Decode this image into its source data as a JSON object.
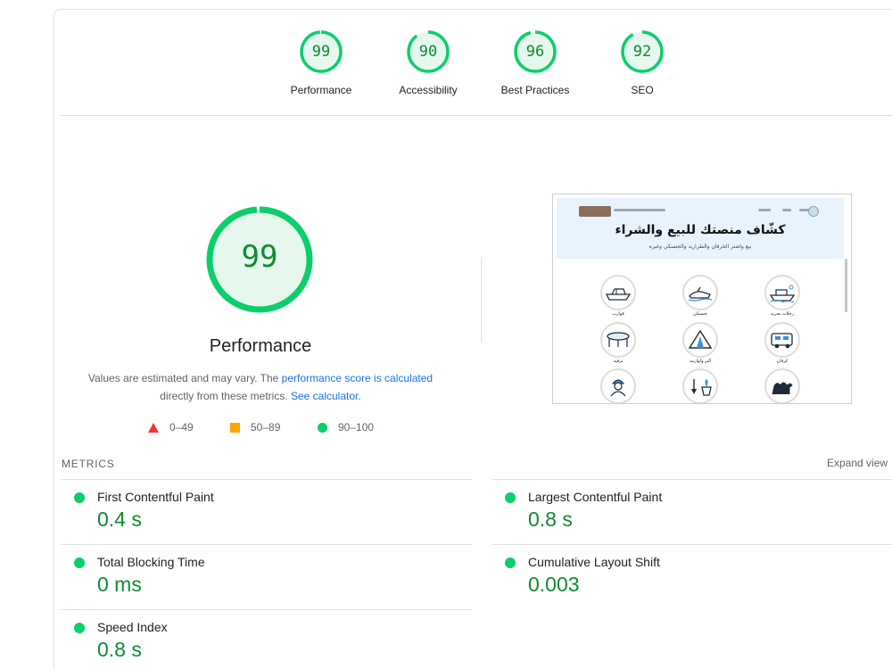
{
  "categories": [
    {
      "label": "Performance",
      "score": "99",
      "fraction": 0.99
    },
    {
      "label": "Accessibility",
      "score": "90",
      "fraction": 0.9
    },
    {
      "label": "Best Practices",
      "score": "96",
      "fraction": 0.96
    },
    {
      "label": "SEO",
      "score": "92",
      "fraction": 0.92
    }
  ],
  "main": {
    "score": "99",
    "fraction": 0.99,
    "title": "Performance",
    "desc_prefix": "Values are estimated and may vary. The ",
    "desc_link1": "performance score is calculated",
    "desc_middle": "directly from these metrics. ",
    "desc_link2": "See calculator",
    "desc_end": "."
  },
  "legend": {
    "fail": "0–49",
    "average": "50–89",
    "pass": "90–100"
  },
  "screenshot": {
    "hero_title": "كشّاف منصتك للبيع والشراء",
    "hero_subtitle": "بيع واشتر الخرفان والطراريد والجتسكي وغيره",
    "items": [
      {
        "label": "رحلات بحرية",
        "icon": "cruise-boat-icon"
      },
      {
        "label": "جتسكي",
        "icon": "jetski-icon"
      },
      {
        "label": "قوارب",
        "icon": "boat-icon"
      },
      {
        "label": "كرفان",
        "icon": "caravan-icon"
      },
      {
        "label": "البر ولوازمه",
        "icon": "tent-icon"
      },
      {
        "label": "ترفيه",
        "icon": "trampoline-icon"
      },
      {
        "label": "",
        "icon": "camel-icon"
      },
      {
        "label": "",
        "icon": "garden-icon"
      },
      {
        "label": "",
        "icon": "worker-icon"
      }
    ]
  },
  "metrics": {
    "title": "METRICS",
    "expand": "Expand view",
    "items": [
      {
        "name": "First Contentful Paint",
        "value": "0.4 s"
      },
      {
        "name": "Largest Contentful Paint",
        "value": "0.8 s"
      },
      {
        "name": "Total Blocking Time",
        "value": "0 ms"
      },
      {
        "name": "Cumulative Layout Shift",
        "value": "0.003"
      },
      {
        "name": "Speed Index",
        "value": "0.8 s"
      }
    ]
  },
  "colors": {
    "pass": "#0cce6b",
    "pass_text": "#0c8c2e",
    "pass_fill": "#e6f7ed",
    "average": "#ffa400",
    "fail": "#ff3333",
    "link": "#1a73e8"
  }
}
